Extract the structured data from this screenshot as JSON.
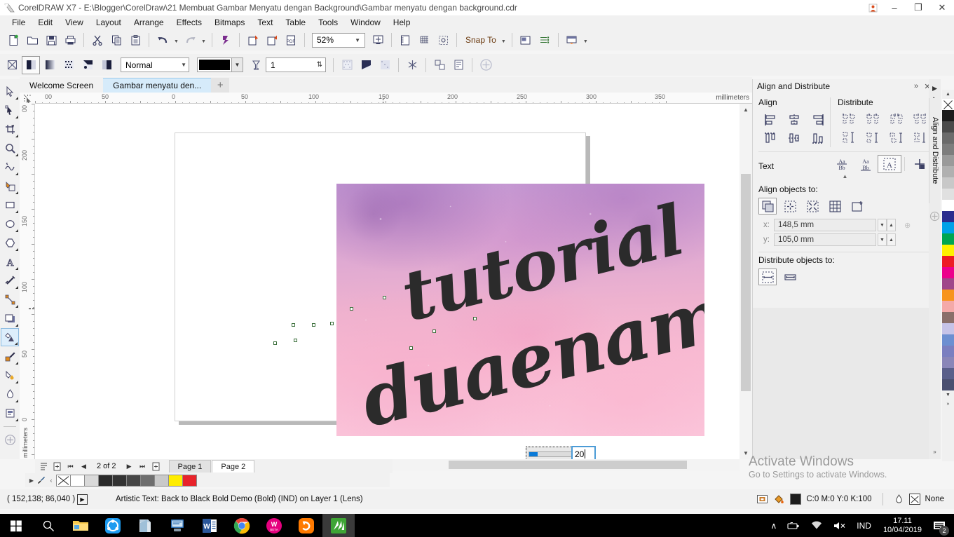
{
  "window": {
    "title": "CorelDRAW X7 - E:\\Blogger\\CorelDraw\\21 Membuat Gambar Menyatu dengan Background\\Gambar menyatu dengan background.cdr",
    "minimize": "–",
    "restore": "❐",
    "close": "✕"
  },
  "menu": {
    "items": [
      {
        "label": "File"
      },
      {
        "label": "Edit"
      },
      {
        "label": "View"
      },
      {
        "label": "Layout"
      },
      {
        "label": "Arrange"
      },
      {
        "label": "Effects"
      },
      {
        "label": "Bitmaps"
      },
      {
        "label": "Text"
      },
      {
        "label": "Table"
      },
      {
        "label": "Tools"
      },
      {
        "label": "Window"
      },
      {
        "label": "Help"
      }
    ]
  },
  "standard_toolbar": {
    "zoom_level": "52%",
    "snap_to": "Snap To",
    "buttons": [
      "new-document",
      "open-document",
      "save-document",
      "print-document",
      "cut",
      "copy",
      "paste",
      "undo",
      "redo",
      "corel-connect",
      "import",
      "export",
      "export-pdf",
      "zoom-levels",
      "full-screen-preview",
      "show-rulers",
      "show-grid",
      "show-guidelines",
      "options",
      "application-launcher"
    ]
  },
  "property_bar": {
    "transparency_mode": "Normal",
    "fill_color": "#000000",
    "transparency_value": "1",
    "buttons": [
      "no-transparency",
      "uniform-transparency",
      "fountain-transparency",
      "pattern-transparency",
      "two-color-pattern",
      "texture-transparency",
      "transparency-target-fill",
      "transparency-target-outline",
      "transparency-target-all",
      "freeze-transparency",
      "copy-transparency",
      "edit-transparency",
      "clear-transparency"
    ]
  },
  "document_tabs": {
    "tabs": [
      {
        "label": "Welcome Screen",
        "active": false
      },
      {
        "label": "Gambar menyatu den...",
        "active": true
      }
    ],
    "new_tab": "+"
  },
  "toolbox": {
    "tools": [
      {
        "name": "pick-tool",
        "selected": false
      },
      {
        "name": "shape-tool",
        "selected": false
      },
      {
        "name": "crop-tool",
        "selected": false
      },
      {
        "name": "zoom-tool",
        "selected": false
      },
      {
        "name": "freehand-tool",
        "selected": false
      },
      {
        "name": "smart-fill-tool",
        "selected": false
      },
      {
        "name": "rectangle-tool",
        "selected": false
      },
      {
        "name": "ellipse-tool",
        "selected": false
      },
      {
        "name": "polygon-tool",
        "selected": false
      },
      {
        "name": "text-tool",
        "selected": false
      },
      {
        "name": "parallel-dimension-tool",
        "selected": false
      },
      {
        "name": "straight-line-connector-tool",
        "selected": false
      },
      {
        "name": "drop-shadow-tool",
        "selected": false
      },
      {
        "name": "transparency-tool",
        "selected": true
      },
      {
        "name": "color-eyedropper-tool",
        "selected": false
      },
      {
        "name": "interactive-fill-tool",
        "selected": false
      },
      {
        "name": "outline-pen-tool",
        "selected": false
      },
      {
        "name": "fill-tool",
        "selected": false
      },
      {
        "name": "quick-customize",
        "selected": false
      }
    ]
  },
  "rulers": {
    "unit": "millimeters",
    "horizontal_labels": [
      "00",
      "50",
      "0",
      "50",
      "100",
      "150",
      "200",
      "250",
      "300",
      "350"
    ],
    "vertical_labels": [
      "00",
      "200",
      "150",
      "100",
      "50",
      "0"
    ]
  },
  "canvas": {
    "artwork": {
      "line1": "tutorial",
      "line2": "duaenam"
    },
    "transparency_popup": {
      "slider_value": 20,
      "field_value": "20"
    }
  },
  "page_nav": {
    "page_indicator": "2 of 2",
    "pages": [
      {
        "label": "Page 1",
        "active": false
      },
      {
        "label": "Page 2",
        "active": true
      }
    ],
    "buttons": [
      "add-page-start",
      "first-page",
      "previous-page",
      "next-page",
      "last-page",
      "add-page-end"
    ]
  },
  "bottom_palette": {
    "swatches": [
      "none",
      "#ffffff",
      "#d9d9d9",
      "#2b2b2b",
      "#333333",
      "#474747",
      "#6e6e6e",
      "#c9c9c9",
      "#ffed00",
      "#e8232a"
    ]
  },
  "status_bar": {
    "coordinates": "( 152,138; 86,040 )",
    "object_info": "Artistic Text: Back to Black Bold Demo (Bold) (IND) on Layer 1  (Lens)",
    "fill_label": "C:0 M:0 Y:0 K:100",
    "fill_color": "#1c1c1c",
    "outline_label": "None",
    "icons": [
      "document-color-settings",
      "fill-icon",
      "outline-pen-icon"
    ]
  },
  "docker": {
    "title": "Align and Distribute",
    "collapse_icon": "»",
    "close_icon": "✕",
    "vertical_tab": "Align and Distribute",
    "align_heading": "Align",
    "distribute_heading": "Distribute",
    "text_heading": "Text",
    "align_objects_to_label": "Align objects to:",
    "distribute_objects_to_label": "Distribute objects to:",
    "x_label": "x:",
    "y_label": "y:",
    "x_value": "148,5 mm",
    "y_value": "105,0 mm",
    "align_buttons": [
      "align-left",
      "align-center-horizontally",
      "align-right",
      "align-top",
      "align-center-vertically",
      "align-bottom"
    ],
    "distribute_buttons": [
      "distribute-left",
      "distribute-center-h",
      "distribute-spacing-h",
      "distribute-right",
      "distribute-top",
      "distribute-center-v",
      "distribute-spacing-v",
      "distribute-bottom"
    ],
    "text_buttons": [
      "align-text-baseline-first",
      "align-text-baseline-last",
      "align-text-bounding-box",
      "align-text-outline"
    ],
    "align_target_buttons": [
      "active-objects",
      "edge-of-page",
      "center-of-page",
      "grid",
      "specified-point"
    ],
    "distribute_target_buttons": [
      "extent-of-selection",
      "extent-of-page"
    ]
  },
  "right_palette": {
    "swatches": [
      "none",
      "#1c1c1c",
      "#4a4a4a",
      "#6b6b6b",
      "#7d7d7d",
      "#9a9a9a",
      "#b0b0b0",
      "#c8c8c8",
      "#e0e0e0",
      "#ffffff",
      "#2b2d8e",
      "#00a2e8",
      "#00a651",
      "#fff200",
      "#ed1c24",
      "#ec008c",
      "#a0468a",
      "#f7941e",
      "#f4a9a8",
      "#8a6f6a",
      "#c6c3e8",
      "#6d8fd1",
      "#7b7fc0",
      "#8a86b8",
      "#5a5f8a",
      "#4a4f70"
    ]
  },
  "watermark": {
    "line1": "Activate Windows",
    "line2": "Go to Settings to activate Windows."
  },
  "taskbar": {
    "items": [
      "start-button",
      "search-icon",
      "file-explorer",
      "ccleaner",
      "notepad-app",
      "teamviewer",
      "word",
      "chrome",
      "wattpad",
      "uc-browser",
      "coreldraw"
    ],
    "tray": {
      "chevron": "∧",
      "language": "IND",
      "time": "17.11",
      "date": "10/04/2019",
      "notification_count": "2"
    }
  }
}
